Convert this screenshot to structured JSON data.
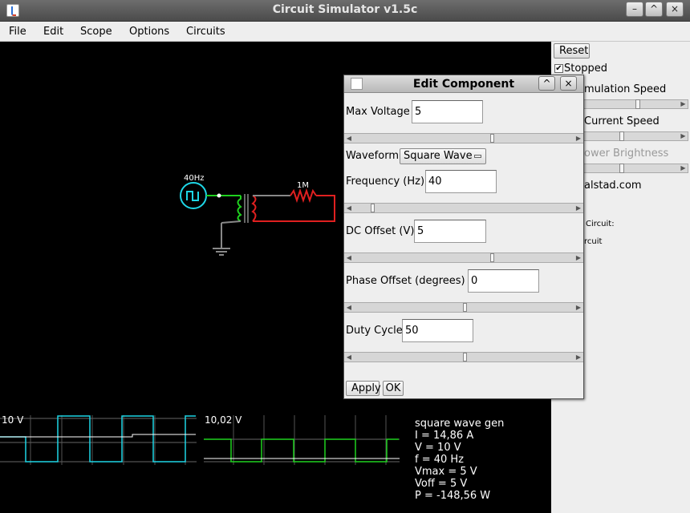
{
  "window": {
    "title": "Circuit Simulator v1.5c",
    "controls": [
      "–",
      "^",
      "×"
    ]
  },
  "menu": [
    "File",
    "Edit",
    "Scope",
    "Options",
    "Circuits"
  ],
  "circuit": {
    "source_label": "40Hz",
    "resistor_label": "1M",
    "colors": {
      "green": "#1fd11f",
      "red": "#e02020",
      "gray": "#888888",
      "cyan": "#1ed6e6"
    }
  },
  "scope": {
    "left_label": "10 V",
    "right_label": "10,02 V",
    "info": [
      "square wave gen",
      "I = 14,86 A",
      "V = 10 V",
      "f = 40 Hz",
      "Vmax = 5 V",
      "Voff = 5 V",
      "P = -148,56 W"
    ]
  },
  "right_panel": {
    "reset_label": "Reset",
    "stopped_label": "Stopped",
    "stopped_checked": true,
    "simulation_speed_partial": "mulation Speed",
    "current_speed_label": "Current Speed",
    "power_brightness_partial": "ower Brightness",
    "site_partial": "alstad.com",
    "circuit_partial": "Circuit:",
    "rcuit_partial": "rcuit"
  },
  "dialog": {
    "title": "Edit Component",
    "max_voltage": {
      "label": "Max Voltage",
      "value": "5"
    },
    "waveform": {
      "label": "Waveform",
      "value": "Square Wave"
    },
    "frequency": {
      "label": "Frequency (Hz)",
      "value": "40"
    },
    "dc_offset": {
      "label": "DC Offset (V)",
      "value": "5"
    },
    "phase_offset": {
      "label": "Phase Offset (degrees)",
      "value": "0"
    },
    "duty_cycle": {
      "label": "Duty Cycle",
      "value": "50"
    },
    "apply_label": "Apply",
    "ok_label": "OK"
  }
}
